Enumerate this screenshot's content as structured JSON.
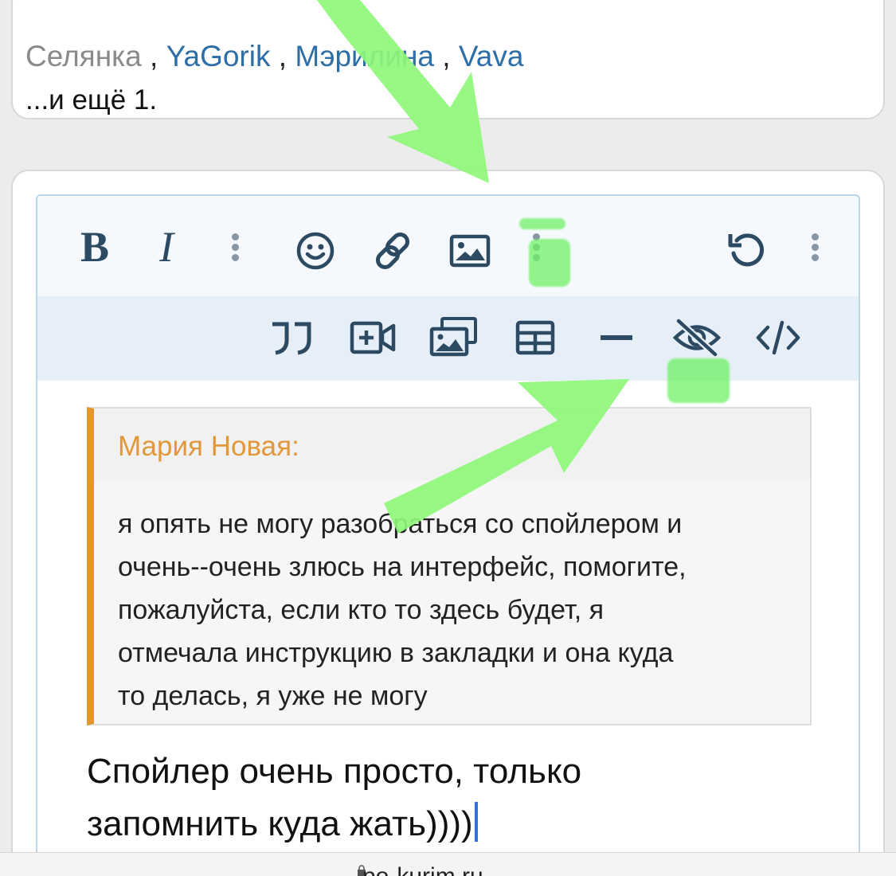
{
  "reactions": {
    "users": [
      "Селянка",
      "YaGorik",
      "Мэрилина",
      "Vava"
    ],
    "separator": " , ",
    "more": "...и ещё 1."
  },
  "toolbar": {
    "row1": [
      {
        "name": "bold-button",
        "icon": "bold-icon"
      },
      {
        "name": "italic-button",
        "icon": "italic-icon"
      },
      {
        "name": "more-text-button",
        "icon": "more-vertical-icon"
      },
      {
        "name": "emoji-button",
        "icon": "smiley-icon"
      },
      {
        "name": "link-button",
        "icon": "link-icon"
      },
      {
        "name": "image-button",
        "icon": "image-icon"
      },
      {
        "name": "more-insert-button",
        "icon": "more-vertical-icon"
      },
      {
        "name": "undo-button",
        "icon": "undo-icon"
      },
      {
        "name": "more-options-button",
        "icon": "more-vertical-icon"
      }
    ],
    "row2": [
      {
        "name": "quote-button",
        "icon": "quote-icon"
      },
      {
        "name": "media-button",
        "icon": "video-plus-icon"
      },
      {
        "name": "gallery-button",
        "icon": "gallery-icon"
      },
      {
        "name": "table-button",
        "icon": "table-icon"
      },
      {
        "name": "hr-button",
        "icon": "horizontal-rule-icon"
      },
      {
        "name": "spoiler-button",
        "icon": "eye-slash-icon"
      },
      {
        "name": "code-button",
        "icon": "code-icon"
      }
    ],
    "icon_color": "#2d4a63"
  },
  "quote": {
    "author": "Мария Новая:",
    "lines": [
      "я опять не могу разобраться со спойлером и",
      "очень--очень злюсь на интерфейс, помогите,",
      "пожалуйста, если кто то здесь будет, я",
      "отмечала инструкцию в закладки и она куда",
      "то делась, я уже не могу"
    ],
    "accent": "#e3962f"
  },
  "reply": {
    "lines": [
      "Спойлер очень просто, только",
      "запомнить куда жать))))"
    ]
  },
  "browser": {
    "url": "po-kurim.ru"
  },
  "annotation_color": "#8ef77a"
}
